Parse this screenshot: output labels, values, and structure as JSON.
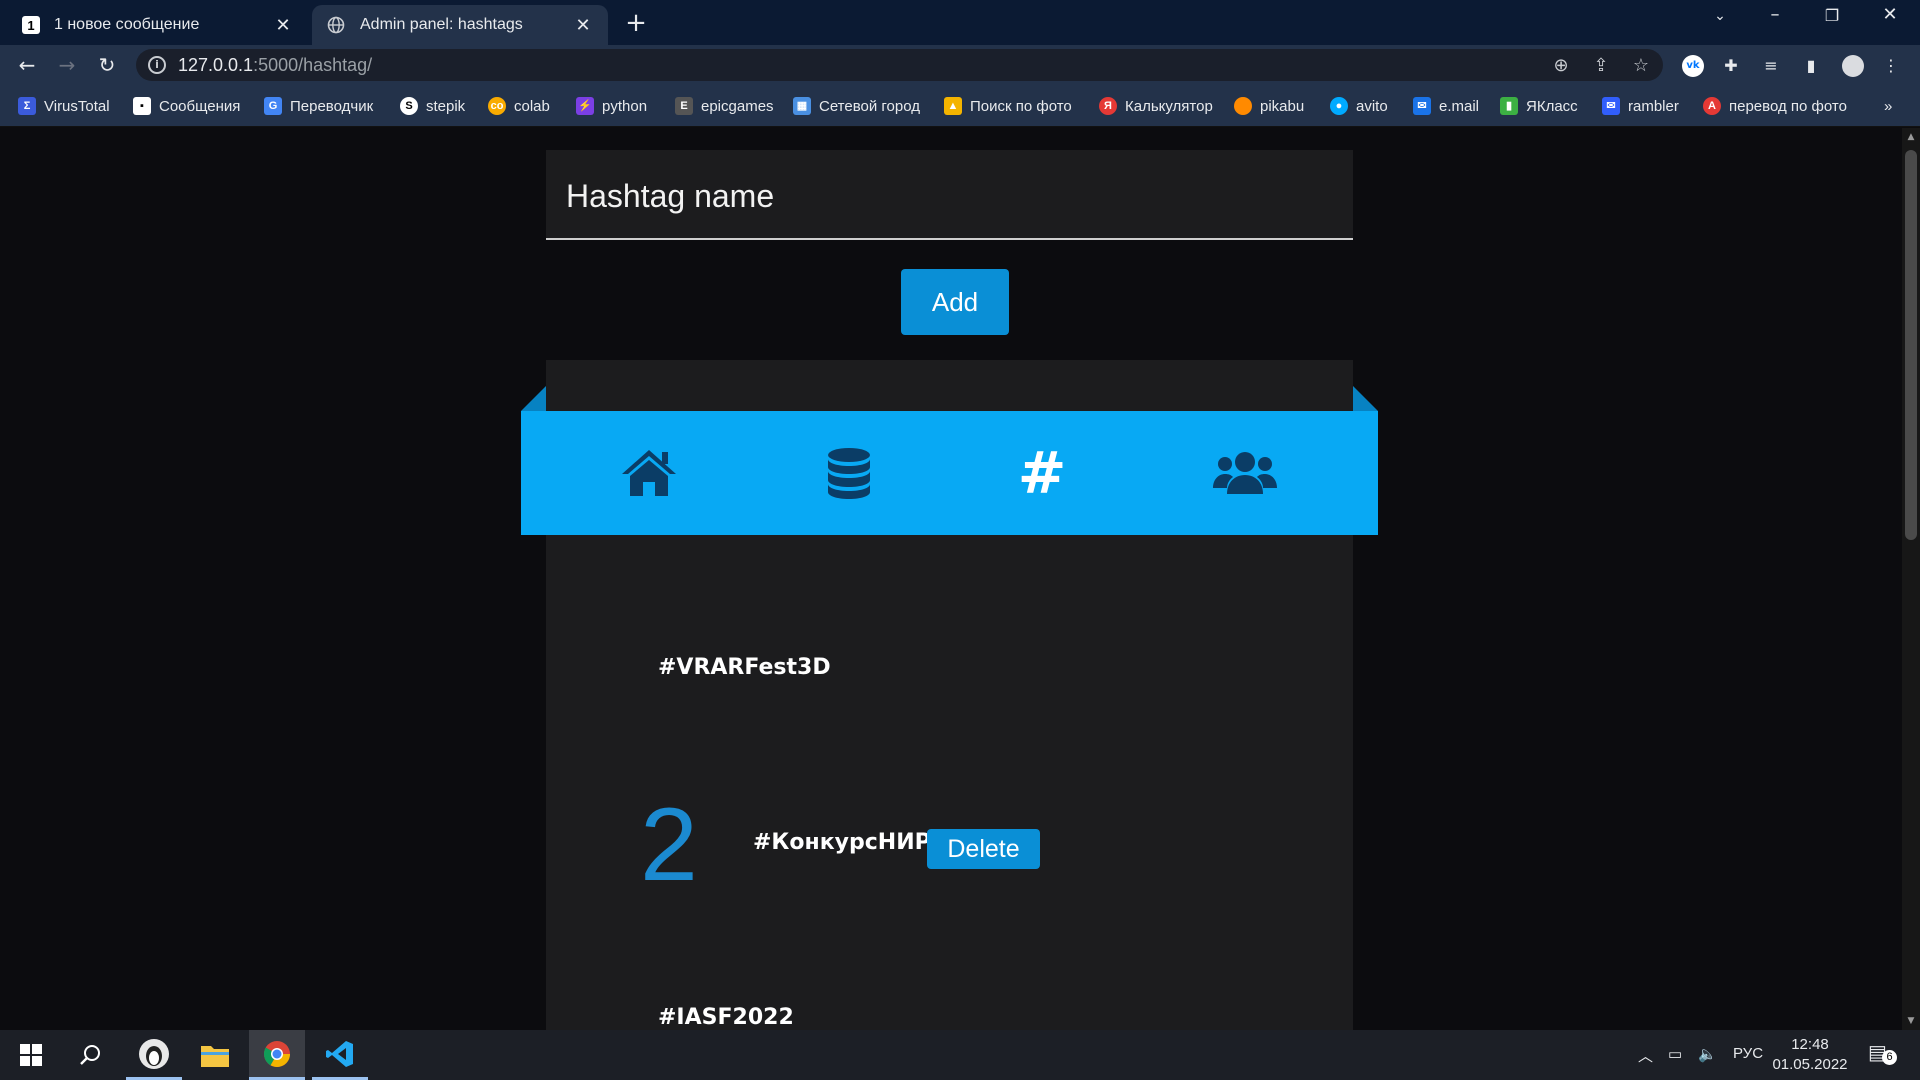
{
  "browser": {
    "tabs": [
      {
        "title": "1 новое сообщение",
        "favicon": "1"
      },
      {
        "title": "Admin panel: hashtags"
      }
    ],
    "url_host": "127.0.0.1",
    "url_rest": ":5000/hashtag/",
    "bookmarks": [
      {
        "label": "VirusTotal",
        "color": "#3b5bdb"
      },
      {
        "label": "Сообщения",
        "color": "#ffffff"
      },
      {
        "label": "Переводчик",
        "color": "#4285f4"
      },
      {
        "label": "stepik",
        "color": "#ffffff"
      },
      {
        "label": "colab",
        "color": "#f9ab00"
      },
      {
        "label": "python",
        "color": "#7b3fe4"
      },
      {
        "label": "epicgames",
        "color": "#555555"
      },
      {
        "label": "Сетевой город",
        "color": "#4a90e2"
      },
      {
        "label": "Поиск по фото",
        "color": "#f4b400"
      },
      {
        "label": "Калькулятор",
        "color": "#e53935"
      },
      {
        "label": "pikabu",
        "color": "#ff8a00"
      },
      {
        "label": "avito",
        "color": "#00aaff"
      },
      {
        "label": "e.mail",
        "color": "#1a73e8"
      },
      {
        "label": "ЯКласс",
        "color": "#3cb043"
      },
      {
        "label": "rambler",
        "color": "#315efb"
      },
      {
        "label": "перевод по фото",
        "color": "#e53935"
      }
    ],
    "bookmarks_overflow": "»"
  },
  "form": {
    "hashtag_label": "Hashtag name",
    "add_label": "Add"
  },
  "nav": {
    "items": [
      "home-icon",
      "database-icon",
      "hashtag-icon",
      "users-icon"
    ],
    "hashtag_glyph": "#",
    "icon_color": "#0b3d66",
    "ribbon_color": "#08a9f4"
  },
  "hashtags": {
    "rows": [
      {
        "tag": "#VRARFest3D"
      },
      {
        "tag": "#КонкурсНИР",
        "number": "2",
        "delete_label": "Delete"
      },
      {
        "tag": "#IASF2022"
      }
    ]
  },
  "taskbar": {
    "lang": "РУС",
    "time": "12:48",
    "date": "01.05.2022",
    "notifications": "6"
  }
}
